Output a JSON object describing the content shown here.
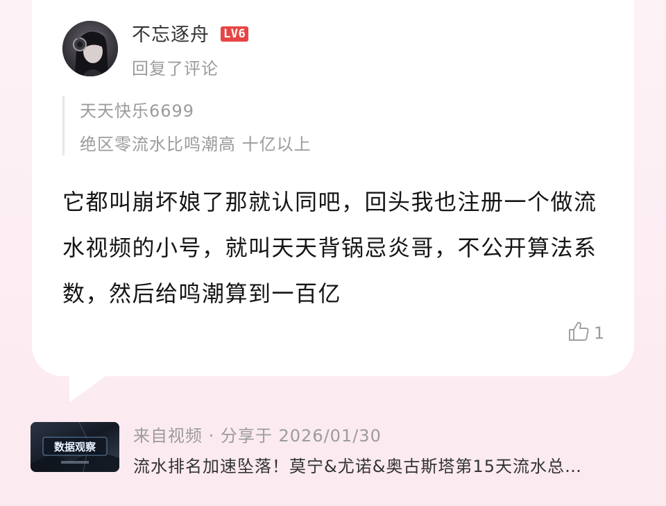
{
  "comment": {
    "username": "不忘逐舟",
    "level": "LV6",
    "action": "回复了评论",
    "quoted": {
      "author": "天天快乐6699",
      "text": "绝区零流水比鸣潮高 十亿以上"
    },
    "text": "它都叫崩坏娘了那就认同吧，回头我也注册一个做流水视频的小号，就叫天天背锅忌炎哥，不公开算法系数，然后给鸣潮算到一百亿",
    "likes": "1"
  },
  "source": {
    "origin": "来自视频 · 分享于 2026/01/30",
    "video_title": "流水排名加速坠落！莫宁&尤诺&奥古斯塔第15天流水总…",
    "thumbnail_text": "数据观察"
  },
  "icons": {
    "like": "thumbs-up-icon"
  },
  "colors": {
    "background": "#fbeef3",
    "level_badge": "#e74545",
    "muted_text": "#9b9b9b"
  }
}
